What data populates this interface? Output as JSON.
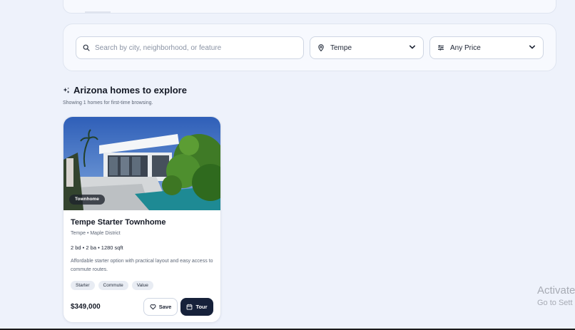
{
  "filters": {
    "search_placeholder": "Search by city, neighborhood, or feature",
    "location_value": "Tempe",
    "price_value": "Any Price"
  },
  "section": {
    "title": "Arizona homes to explore",
    "subtitle": "Showing 1 homes for first-time browsing."
  },
  "listing": {
    "badge": "Townhome",
    "title": "Tempe Starter Townhome",
    "location": "Tempe • Maple District",
    "specs": "2 bd • 2 ba • 1280 sqft",
    "description": "Affordable starter option with practical layout and easy access to commute routes.",
    "tags": [
      "Starter",
      "Commute",
      "Value"
    ],
    "price": "$349,000",
    "save_label": "Save",
    "tour_label": "Tour"
  },
  "watermark": {
    "line1": "Activate",
    "line2": "Go to Sett"
  },
  "icons": {
    "search": "search-icon",
    "location": "map-pin-icon",
    "price": "sliders-icon",
    "chevron": "chevron-down-icon",
    "sparkle": "sparkle-icon",
    "heart": "heart-icon",
    "calendar": "calendar-icon"
  },
  "colors": {
    "page_bg": "#eef2fb",
    "panel_bg": "#f7f9fe",
    "primary_button": "#16213a"
  }
}
